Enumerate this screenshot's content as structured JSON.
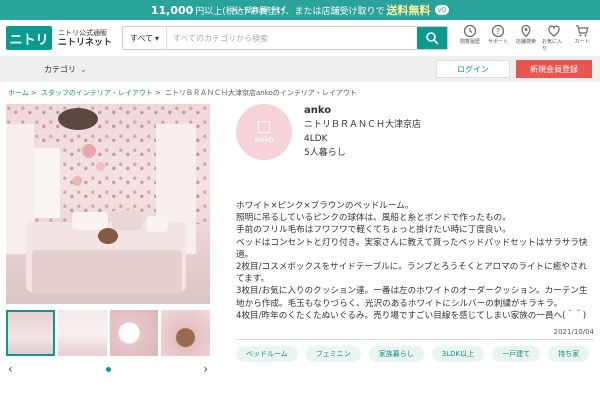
{
  "topbar": {
    "amount": "11,000",
    "text": "円以上(税込) お買上げ、または店舗受け取りで",
    "free": "送料無料",
    "badge": "v0",
    "right": "※一部商品を除く"
  },
  "header": {
    "logo": "ニトリ",
    "brand_line1": "ニトリ公式通販",
    "brand_line2": "ニトリネット",
    "search_category": "すべて",
    "search_placeholder": "すべてのカテゴリから検索",
    "icons": [
      {
        "name": "history-icon",
        "label": "閲覧履歴"
      },
      {
        "name": "support-icon",
        "label": "サポート"
      },
      {
        "name": "store-icon",
        "label": "店舗検索"
      },
      {
        "name": "favorite-icon",
        "label": "お気に入り"
      },
      {
        "name": "cart-icon",
        "label": "カート"
      }
    ]
  },
  "nav": {
    "category": "カテゴリ",
    "login": "ログイン",
    "signup": "新規会員登録"
  },
  "breadcrumb": {
    "home": "ホーム",
    "staff": "スタッフのインテリア・レイアウト",
    "current": "ニトリＢＲＡＮＣＨ大津京店ankoのインテリア・レイアウト"
  },
  "profile": {
    "avatar_text": "anko",
    "name": "anko",
    "store": "ニトリＢＲＡＮＣＨ大津京店",
    "layout": "4LDK",
    "family": "5人暮らし"
  },
  "description": [
    "ホワイト×ピンク×ブラウンのベッドルーム。",
    "照明に吊るしているピンクの球体は、風船と糸とボンドで作ったもの。",
    "手前のフリル毛布はフワフワで軽くてちょっと掛けたい時に丁度良い。",
    "ベッドはコンセントと灯り付き。実家さんに教えて貰ったベッドパッドセットはサラサラ快適。",
    "2枚目/コスメボックスをサイドテーブルに。ランプとろうそくとアロマのライトに癒やされてます。",
    "3枚目/お気に入りのクッション達。一番は左のホワイトのオーダークッション。カーテン生地から作成。毛玉もなりづらく、光沢のあるホワイトにシルバーの刺繍がキラキラ。",
    "4枚目/昨年のくたくたぬいぐるみ。売り場ですごい目線を感じてしまい家族の一員へ(＾＾)"
  ],
  "date": "2021/10/04",
  "tags": [
    "ベッドルーム",
    "フェミニン",
    "家族暮らし",
    "3LDK以上",
    "一戸建て",
    "持ち家"
  ]
}
